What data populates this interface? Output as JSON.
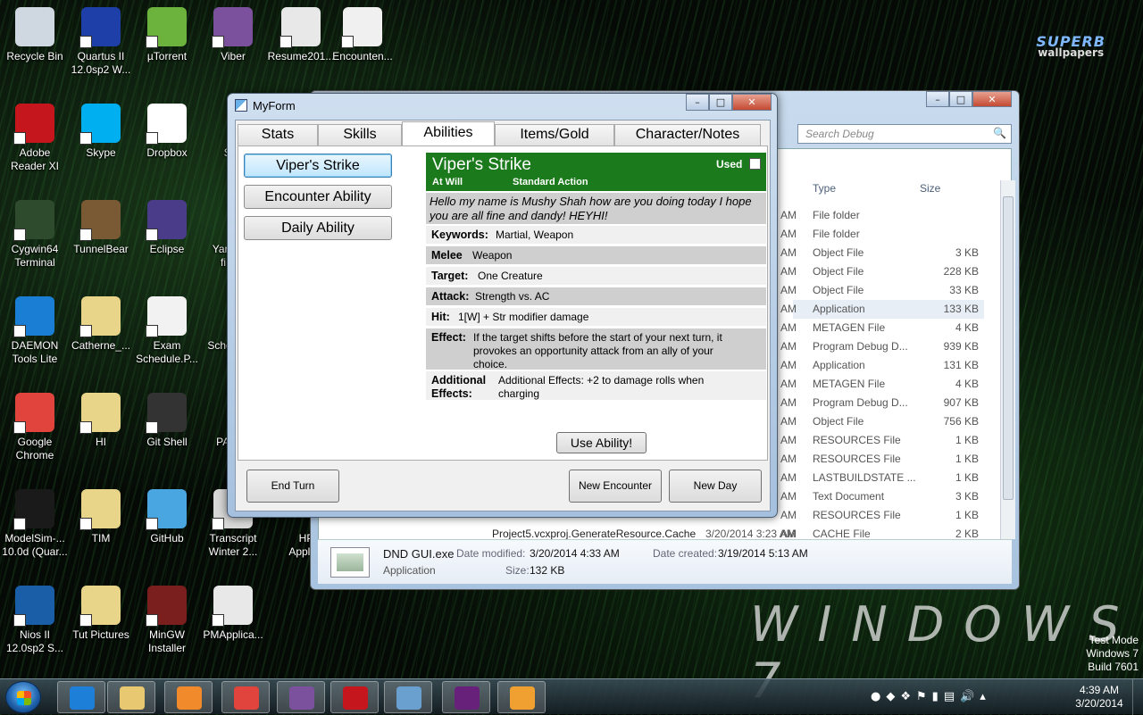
{
  "desktop": {
    "icons": [
      {
        "label": "Recycle Bin",
        "icon": "recycle-bin-icon",
        "color": "#cfd8e0"
      },
      {
        "label": "Quartus II\n12.0sp2 W...",
        "icon": "quartus-icon",
        "color": "#1e3ea8"
      },
      {
        "label": "µTorrent",
        "icon": "utorrent-icon",
        "color": "#6cb33e"
      },
      {
        "label": "Viber",
        "icon": "viber-icon",
        "color": "#7b519d"
      },
      {
        "label": "Resume201...",
        "icon": "pdf-icon",
        "color": "#e8e8e8"
      },
      {
        "label": "Encounten...",
        "icon": "app-screenshot-icon",
        "color": "#f0f0f0"
      },
      {
        "label": "Adobe\nReader XI",
        "icon": "adobe-reader-icon",
        "color": "#c4161c"
      },
      {
        "label": "Skype",
        "icon": "skype-icon",
        "color": "#00aff0"
      },
      {
        "label": "Dropbox",
        "icon": "dropbox-icon",
        "color": "#ffffff"
      },
      {
        "label": "Cygwin64\nTerminal",
        "icon": "cygwin-icon",
        "color": "#2e4b2e"
      },
      {
        "label": "TunnelBear",
        "icon": "tunnelbear-icon",
        "color": "#7a5a34"
      },
      {
        "label": "Eclipse",
        "icon": "eclipse-icon",
        "color": "#4b3c8a"
      },
      {
        "label": "DAEMON\nTools Lite",
        "icon": "daemon-tools-icon",
        "color": "#1a7ed4"
      },
      {
        "label": "Catherne_...",
        "icon": "folder-icon",
        "color": "#e8d58a"
      },
      {
        "label": "Exam\nSchedule.P...",
        "icon": "document-icon",
        "color": "#f2f2f2"
      },
      {
        "label": "Google\nChrome",
        "icon": "chrome-icon",
        "color": "#e0443c"
      },
      {
        "label": "HI",
        "icon": "folder-icon",
        "color": "#e8d58a"
      },
      {
        "label": "Git Shell",
        "icon": "git-shell-icon",
        "color": "#333333"
      },
      {
        "label": "ModelSim-...\n10.0d (Quar...",
        "icon": "modelsim-icon",
        "color": "#1a1a1a"
      },
      {
        "label": "TIM",
        "icon": "folder-icon",
        "color": "#e8d58a"
      },
      {
        "label": "GitHub",
        "icon": "github-icon",
        "color": "#4aa6e0"
      },
      {
        "label": "Transcript\nWinter 2...",
        "icon": "pdf-icon",
        "color": "#d8d8d8"
      },
      {
        "label": "Nios II\n12.0sp2 S...",
        "icon": "nios-icon",
        "color": "#1a5ea8"
      },
      {
        "label": "Tut Pictures",
        "icon": "folder-icon",
        "color": "#e8d58a"
      },
      {
        "label": "MinGW\nInstaller",
        "icon": "mingw-icon",
        "color": "#7a1e1e"
      },
      {
        "label": "PMApplica...",
        "icon": "pdf-icon",
        "color": "#e8e8e8"
      }
    ],
    "partial_labels": [
      "Sp",
      "Yara\nfi",
      "Sche",
      "PAN",
      "HP\nApplica"
    ],
    "wallpaper_logo": {
      "line1": "SUPERB",
      "line2": "wallpapers"
    },
    "windows_watermark": "WINDOWS 7",
    "test_mode": [
      "Test Mode",
      "Windows 7",
      "Build 7601"
    ]
  },
  "explorer": {
    "search_placeholder": "Search Debug",
    "columns": {
      "type": "Type",
      "size": "Size"
    },
    "rows": [
      {
        "type": "File folder",
        "size": ""
      },
      {
        "type": "File folder",
        "size": ""
      },
      {
        "type": "Object File",
        "size": "3 KB"
      },
      {
        "type": "Object File",
        "size": "228 KB"
      },
      {
        "type": "Object File",
        "size": "33 KB"
      },
      {
        "type": "Application",
        "size": "133 KB"
      },
      {
        "type": "METAGEN File",
        "size": "4 KB"
      },
      {
        "type": "Program Debug D...",
        "size": "939 KB"
      },
      {
        "type": "Application",
        "size": "131 KB"
      },
      {
        "type": "METAGEN File",
        "size": "4 KB"
      },
      {
        "type": "Program Debug D...",
        "size": "907 KB"
      },
      {
        "type": "Object File",
        "size": "756 KB"
      },
      {
        "type": "RESOURCES File",
        "size": "1 KB"
      },
      {
        "type": "RESOURCES File",
        "size": "1 KB"
      },
      {
        "type": "LASTBUILDSTATE ...",
        "size": "1 KB"
      },
      {
        "type": "Text Document",
        "size": "3 KB"
      },
      {
        "type": "RESOURCES File",
        "size": "1 KB"
      },
      {
        "type": "CACHE File",
        "size": "2 KB"
      }
    ],
    "row_am": "AM",
    "partial_row": {
      "name": "Project5.vcxproj.GenerateResource.Cache",
      "date": "3/20/2014 3:23 AM"
    },
    "details": {
      "name": "DND GUI.exe",
      "kind": "Application",
      "modified_label": "Date modified:",
      "modified": "3/20/2014 4:33 AM",
      "created_label": "Date created:",
      "created": "3/19/2014 5:13 AM",
      "size_label": "Size:",
      "size": "132 KB"
    }
  },
  "myform": {
    "title": "MyForm",
    "tabs": [
      "Stats",
      "Skills",
      "Abilities",
      "Items/Gold",
      "Character/Notes"
    ],
    "ability_buttons": [
      "Viper's Strike",
      "Encounter Ability",
      "Daily Ability"
    ],
    "card": {
      "name": "Viper's Strike",
      "frequency": "At Will",
      "action": "Standard Action",
      "used_label": "Used",
      "flavor": "Hello my name is Mushy Shah how are you doing today I hope you are all fine and dandy! HEYHI!",
      "rows": [
        {
          "key": "Keywords:",
          "value": "Martial, Weapon"
        },
        {
          "key": "Melee",
          "value": "Weapon"
        },
        {
          "key": "Target:",
          "value": "One Creature"
        },
        {
          "key": "Attack:",
          "value": "Strength vs. AC"
        },
        {
          "key": "Hit:",
          "value": "1[W] + Str modifier damage"
        },
        {
          "key": "Effect:",
          "value": "If the target shifts before the start of your next turn, it provokes an opportunity attack from an ally of your choice."
        },
        {
          "key": "Additional Effects:",
          "value": "Additional Effects: +2 to damage rolls when charging"
        }
      ]
    },
    "use_button": "Use Ability!",
    "end_turn": "End Turn",
    "new_encounter": "New Encounter",
    "new_day": "New Day"
  },
  "taskbar": {
    "time": "4:39 AM",
    "date": "3/20/2014",
    "apps": [
      {
        "icon": "internet-explorer-icon",
        "color": "#1e7fd8"
      },
      {
        "icon": "file-explorer-icon",
        "color": "#e8c870"
      },
      {
        "icon": "media-player-icon",
        "color": "#f08a2a"
      },
      {
        "icon": "chrome-icon",
        "color": "#e0443c"
      },
      {
        "icon": "viber-icon",
        "color": "#7b519d"
      },
      {
        "icon": "adobe-reader-icon",
        "color": "#c4161c"
      },
      {
        "icon": "photo-viewer-icon",
        "color": "#6aa0d0"
      },
      {
        "icon": "visual-studio-icon",
        "color": "#68217a"
      },
      {
        "icon": "myform-app-icon",
        "color": "#f0a030"
      }
    ]
  }
}
